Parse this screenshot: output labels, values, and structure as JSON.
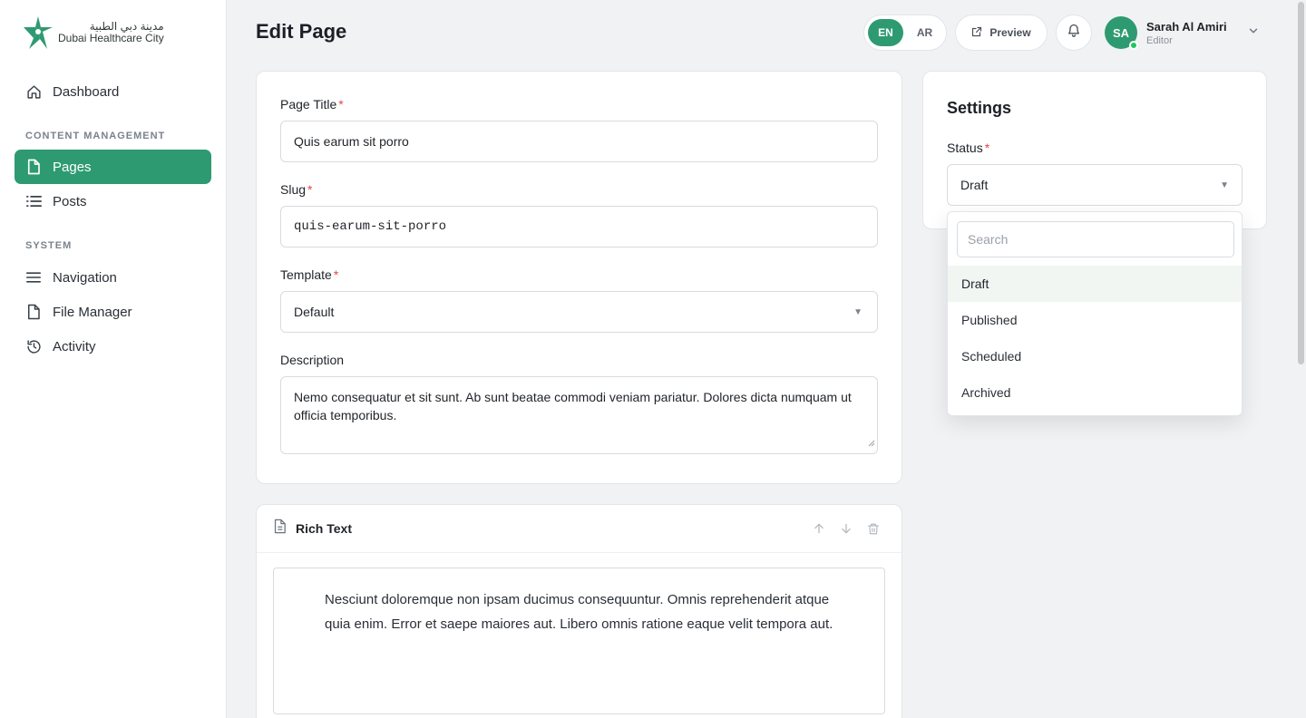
{
  "brand": {
    "name_ar": "مدينة دبي الطبية",
    "name_en": "Dubai Healthcare City",
    "accent": "#2e9a72"
  },
  "sidebar": {
    "items_top": [
      {
        "label": "Dashboard",
        "icon": "home-icon"
      }
    ],
    "section_content": "CONTENT MANAGEMENT",
    "items_content": [
      {
        "label": "Pages",
        "icon": "file-icon",
        "active": true
      },
      {
        "label": "Posts",
        "icon": "list-icon"
      }
    ],
    "section_system": "SYSTEM",
    "items_system": [
      {
        "label": "Navigation",
        "icon": "menu-icon"
      },
      {
        "label": "File Manager",
        "icon": "file-icon"
      },
      {
        "label": "Activity",
        "icon": "history-icon"
      }
    ]
  },
  "header": {
    "title": "Edit Page",
    "lang": {
      "en": "EN",
      "ar": "AR",
      "active": "EN"
    },
    "preview_label": "Preview",
    "user": {
      "initials": "SA",
      "name": "Sarah Al Amiri",
      "role": "Editor"
    }
  },
  "form": {
    "title_label": "Page Title",
    "title_value": "Quis earum sit porro",
    "slug_label": "Slug",
    "slug_value": "quis-earum-sit-porro",
    "template_label": "Template",
    "template_value": "Default",
    "description_label": "Description",
    "description_value": "Nemo consequatur et sit sunt. Ab sunt beatae commodi veniam pariatur. Dolores dicta numquam ut officia temporibus.",
    "required_mark": "*"
  },
  "rich_text": {
    "title": "Rich Text",
    "content": "Nesciunt doloremque non ipsam ducimus consequuntur. Omnis reprehenderit atque quia enim. Error et saepe maiores aut. Libero omnis ratione eaque velit tempora aut."
  },
  "settings": {
    "title": "Settings",
    "status_label": "Status",
    "status_value": "Draft",
    "dropdown": {
      "search_placeholder": "Search",
      "options": [
        "Draft",
        "Published",
        "Scheduled",
        "Archived"
      ],
      "selected": "Draft"
    }
  }
}
